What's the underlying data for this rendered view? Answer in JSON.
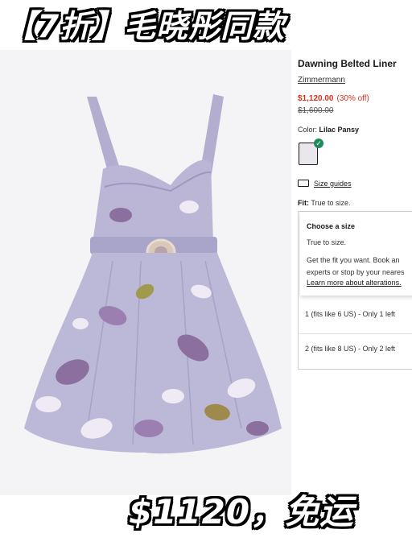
{
  "banner": {
    "top": "【7折】毛晓彤同款",
    "bottom": "$1120，免运"
  },
  "product": {
    "title": "Dawning Belted Liner",
    "brand": "Zimmermann",
    "price": "$1,120.00",
    "discount": "(30% off)",
    "original_price": "$1,600.00",
    "color_label": "Color:",
    "color_value": "Lilac Pansy",
    "size_guides": "Size guides",
    "fit_label": "Fit:",
    "fit_value": "True to size."
  },
  "size_popup": {
    "header": "Choose a size",
    "line1": "True to size.",
    "line2a": "Get the fit you want. Book an",
    "line2b": "experts or stop by your neares",
    "link": "Learn more about alterations."
  },
  "sizes": [
    {
      "label": "1 (fits like 6 US) - Only 1 left"
    },
    {
      "label": "2 (fits like 8 US) - Only 2 left"
    }
  ],
  "colors": {
    "sale": "#d6331f",
    "check": "#1f8a5b",
    "dress": "#b9b5d3",
    "petal": "#8b6f9f"
  }
}
